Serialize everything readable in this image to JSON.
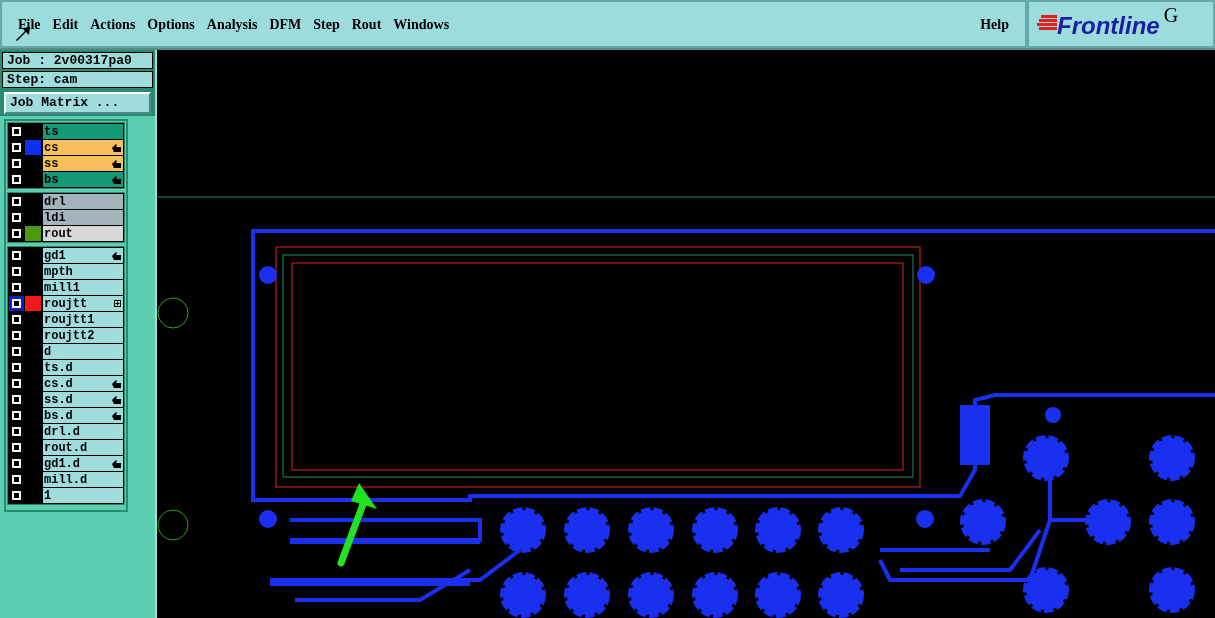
{
  "menu_bar": {
    "items": [
      "File",
      "Edit",
      "Actions",
      "Options",
      "Analysis",
      "DFM",
      "Step",
      "Rout",
      "Windows"
    ],
    "help": "Help"
  },
  "logo": {
    "text": "Frontline",
    "trailing": "G"
  },
  "job_panel": {
    "job": "Job : 2v00317pa0",
    "step": "Step: cam",
    "matrix_button": "Job Matrix ..."
  },
  "layer_groups": [
    {
      "layers": [
        {
          "name": "ts",
          "color": "#149a78",
          "kind": "plain",
          "selected": false
        },
        {
          "name": "cs",
          "color": "#f8c05c",
          "swatch": {
            "color": "#1030f0"
          },
          "kind": "hand",
          "selected": false
        },
        {
          "name": "ss",
          "color": "#f8c05c",
          "kind": "hand",
          "selected": false
        },
        {
          "name": "bs",
          "color": "#149a78",
          "kind": "hand",
          "selected": false
        }
      ]
    },
    {
      "layers": [
        {
          "name": "drl",
          "color": "#a4b4bc",
          "kind": "plain",
          "selected": false
        },
        {
          "name": "ldi",
          "color": "#a4b4bc",
          "kind": "plain",
          "selected": false
        },
        {
          "name": "rout",
          "color": "#d8d8d8",
          "swatch": {
            "color": "#4c9a10"
          },
          "kind": "plain",
          "selected": false
        }
      ]
    },
    {
      "layers": [
        {
          "name": "gd1",
          "color": "#a0dcdc",
          "kind": "hand",
          "selected": false
        },
        {
          "name": "mpth",
          "color": "#a0dcdc",
          "kind": "plain",
          "selected": false
        },
        {
          "name": "mill1",
          "color": "#a0dcdc",
          "kind": "plain",
          "selected": false
        },
        {
          "name": "roujtt",
          "color": "#a0dcdc",
          "swatch": {
            "color": "#f01818"
          },
          "kind": "plus",
          "selected": true
        },
        {
          "name": "roujtt1",
          "color": "#a0dcdc",
          "kind": "plain",
          "selected": false
        },
        {
          "name": "roujtt2",
          "color": "#a0dcdc",
          "kind": "plain",
          "selected": false
        },
        {
          "name": "d",
          "color": "#a0dcdc",
          "kind": "plain",
          "selected": false
        },
        {
          "name": "ts.d",
          "color": "#a0dcdc",
          "kind": "plain",
          "selected": false
        },
        {
          "name": "cs.d",
          "color": "#a0dcdc",
          "kind": "hand",
          "selected": false
        },
        {
          "name": "ss.d",
          "color": "#a0dcdc",
          "kind": "hand",
          "selected": false
        },
        {
          "name": "bs.d",
          "color": "#a0dcdc",
          "kind": "hand",
          "selected": false
        },
        {
          "name": "drl.d",
          "color": "#a0dcdc",
          "kind": "plain",
          "selected": false
        },
        {
          "name": "rout.d",
          "color": "#a0dcdc",
          "kind": "plain",
          "selected": false
        },
        {
          "name": "gd1.d",
          "color": "#a0dcdc",
          "kind": "hand",
          "selected": false
        },
        {
          "name": "mill.d",
          "color": "#a0dcdc",
          "kind": "plain",
          "selected": false
        },
        {
          "name": "1",
          "color": "#a0dcdc",
          "kind": "plain",
          "selected": false
        }
      ]
    }
  ]
}
